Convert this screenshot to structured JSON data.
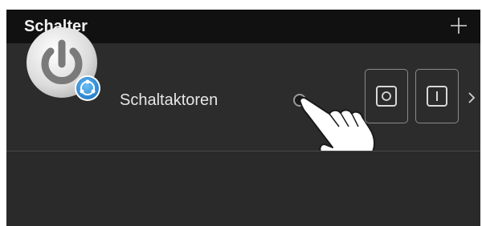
{
  "header": {
    "title": "Schalter",
    "add_icon": "plus-icon"
  },
  "device_row": {
    "label": "Schaltaktoren",
    "icon": "power-icon",
    "badge_icon": "share-icon",
    "off_button_icon": "circle-icon",
    "on_button_icon": "bar-icon",
    "more_icon": "chevron-right-icon"
  },
  "colors": {
    "header_bg": "#111111",
    "content_bg": "#2b2b2b",
    "badge_blue": "#2f8fd8"
  }
}
